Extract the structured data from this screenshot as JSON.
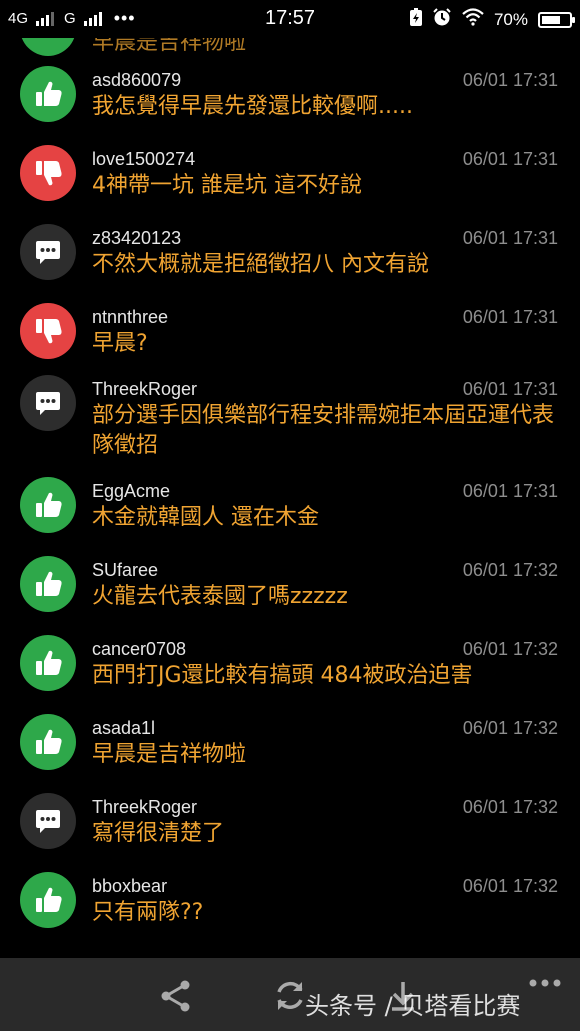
{
  "status_bar": {
    "network_1": "4G",
    "network_2": "G",
    "time": "17:57",
    "battery": "70%",
    "battery_level": 0.7
  },
  "comments": [
    {
      "user": "asd860079",
      "time": "06/01 17:31",
      "text": "我怎覺得早晨先發還比較優啊.....",
      "vote": "up",
      "icon": "thumbs-up-icon"
    },
    {
      "user": "love1500274",
      "time": "06/01 17:31",
      "text": "4神帶一坑 誰是坑 這不好說",
      "vote": "down",
      "icon": "thumbs-down-icon"
    },
    {
      "user": "z83420123",
      "time": "06/01 17:31",
      "text": "不然大概就是拒絕徵招八 內文有說",
      "vote": "neutral",
      "icon": "speech-bubble-icon"
    },
    {
      "user": "ntnnthree",
      "time": "06/01 17:31",
      "text": "早晨?",
      "vote": "down",
      "icon": "thumbs-down-icon"
    },
    {
      "user": "ThreekRoger",
      "time": "06/01 17:31",
      "text": "部分選手因俱樂部行程安排需婉拒本屆亞運代表隊徵招",
      "vote": "neutral",
      "icon": "speech-bubble-icon"
    },
    {
      "user": "EggAcme",
      "time": "06/01 17:31",
      "text": "木金就韓國人 還在木金",
      "vote": "up",
      "icon": "thumbs-up-icon"
    },
    {
      "user": "SUfaree",
      "time": "06/01 17:32",
      "text": "火龍去代表泰國了嗎zzzzz",
      "vote": "up",
      "icon": "thumbs-up-icon"
    },
    {
      "user": "cancer0708",
      "time": "06/01 17:32",
      "text": "西門打JG還比較有搞頭 484被政治迫害",
      "vote": "up",
      "icon": "thumbs-up-icon"
    },
    {
      "user": "asada1l",
      "time": "06/01 17:32",
      "text": "早晨是吉祥物啦",
      "vote": "up",
      "icon": "thumbs-up-icon"
    },
    {
      "user": "ThreekRoger",
      "time": "06/01 17:32",
      "text": "寫得很清楚了",
      "vote": "neutral",
      "icon": "speech-bubble-icon"
    },
    {
      "user": "bboxbear",
      "time": "06/01 17:32",
      "text": "只有兩隊??",
      "vote": "up",
      "icon": "thumbs-up-icon"
    }
  ],
  "partial_top_text": "早晨是吉祥物啦",
  "bottom_bar": {
    "share_icon": "share-icon",
    "refresh_icon": "refresh-icon",
    "download_icon": "download-icon",
    "more_icon": "more-dots-icon",
    "watermark": "头条号 / 贝塔看比赛"
  },
  "colors": {
    "up": "#2ea84a",
    "down": "#e54343",
    "neutral": "#2d2d2d",
    "comment_text": "#f0a432",
    "timestamp": "#8e8e8e"
  }
}
